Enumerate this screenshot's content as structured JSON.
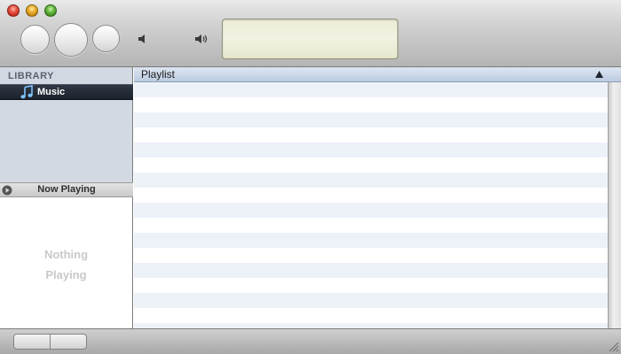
{
  "toolbar": {
    "previous_icon": "previous-button",
    "play_icon": "play-button",
    "next_icon": "next-button",
    "volume_low_icon": "speaker-low-icon",
    "volume_high_icon": "speaker-high-icon"
  },
  "sidebar": {
    "library_header": "LIBRARY",
    "items": [
      {
        "label": "Music",
        "icon": "music-note-icon",
        "selected": true
      }
    ],
    "now_playing": {
      "header": "Now Playing",
      "line1": "Nothing",
      "line2": "Playing"
    }
  },
  "playlist": {
    "column_header": "Playlist",
    "sort_icon": "sort-ascending-icon",
    "row_colors": [
      "#edf2f9",
      "#ffffff"
    ]
  },
  "colors": {
    "selection": "#1c222b",
    "lcd": "#f0f0dc",
    "sidebar": "#d3d9e2"
  }
}
